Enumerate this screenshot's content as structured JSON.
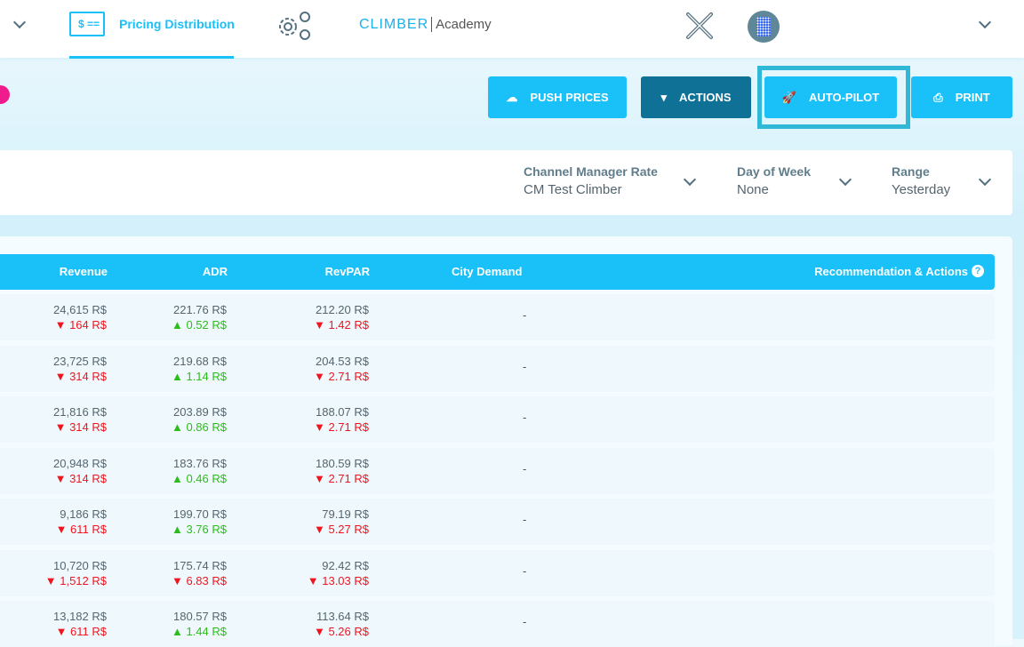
{
  "nav": {
    "tab_label": "Pricing Distribution",
    "tab_icon": "$ ==",
    "logo_brand": "CLIMBER",
    "logo_sub": "Academy"
  },
  "actions": {
    "push": "PUSH PRICES",
    "actions": "ACTIONS",
    "autopilot": "AUTO-PILOT",
    "print": "PRINT"
  },
  "filters": [
    {
      "label": "Channel Manager Rate",
      "value": "CM Test Climber"
    },
    {
      "label": "Day of Week",
      "value": "None"
    },
    {
      "label": "Range",
      "value": "Yesterday"
    }
  ],
  "table": {
    "headers": {
      "revenue": "Revenue",
      "adr": "ADR",
      "revpar": "RevPAR",
      "city": "City Demand",
      "rec": "Recommendation & Actions"
    },
    "rows": [
      {
        "revenue": "24,615 R$",
        "revenue_d": "▼ 164 R$",
        "revenue_t": "d",
        "adr": "221.76 R$",
        "adr_d": "▲ 0.52 R$",
        "adr_t": "u",
        "revpar": "212.20 R$",
        "revpar_d": "▼ 1.42 R$",
        "revpar_t": "d",
        "city": "-"
      },
      {
        "revenue": "23,725 R$",
        "revenue_d": "▼ 314 R$",
        "revenue_t": "d",
        "adr": "219.68 R$",
        "adr_d": "▲ 1.14 R$",
        "adr_t": "u",
        "revpar": "204.53 R$",
        "revpar_d": "▼ 2.71 R$",
        "revpar_t": "d",
        "city": "-"
      },
      {
        "revenue": "21,816 R$",
        "revenue_d": "▼ 314 R$",
        "revenue_t": "d",
        "adr": "203.89 R$",
        "adr_d": "▲ 0.86 R$",
        "adr_t": "u",
        "revpar": "188.07 R$",
        "revpar_d": "▼ 2.71 R$",
        "revpar_t": "d",
        "city": "-"
      },
      {
        "revenue": "20,948 R$",
        "revenue_d": "▼ 314 R$",
        "revenue_t": "d",
        "adr": "183.76 R$",
        "adr_d": "▲ 0.46 R$",
        "adr_t": "u",
        "revpar": "180.59 R$",
        "revpar_d": "▼ 2.71 R$",
        "revpar_t": "d",
        "city": "-"
      },
      {
        "revenue": "9,186 R$",
        "revenue_d": "▼ 611 R$",
        "revenue_t": "d",
        "adr": "199.70 R$",
        "adr_d": "▲ 3.76 R$",
        "adr_t": "u",
        "revpar": "79.19 R$",
        "revpar_d": "▼ 5.27 R$",
        "revpar_t": "d",
        "city": "-"
      },
      {
        "revenue": "10,720 R$",
        "revenue_d": "▼ 1,512 R$",
        "revenue_t": "d",
        "adr": "175.74 R$",
        "adr_d": "▼ 6.83 R$",
        "adr_t": "d",
        "revpar": "92.42 R$",
        "revpar_d": "▼ 13.03 R$",
        "revpar_t": "d",
        "city": "-"
      },
      {
        "revenue": "13,182 R$",
        "revenue_d": "▼ 611 R$",
        "revenue_t": "d",
        "adr": "180.57 R$",
        "adr_d": "▲ 1.44 R$",
        "adr_t": "u",
        "revpar": "113.64 R$",
        "revpar_d": "▼ 5.26 R$",
        "revpar_t": "d",
        "city": "-"
      }
    ]
  }
}
